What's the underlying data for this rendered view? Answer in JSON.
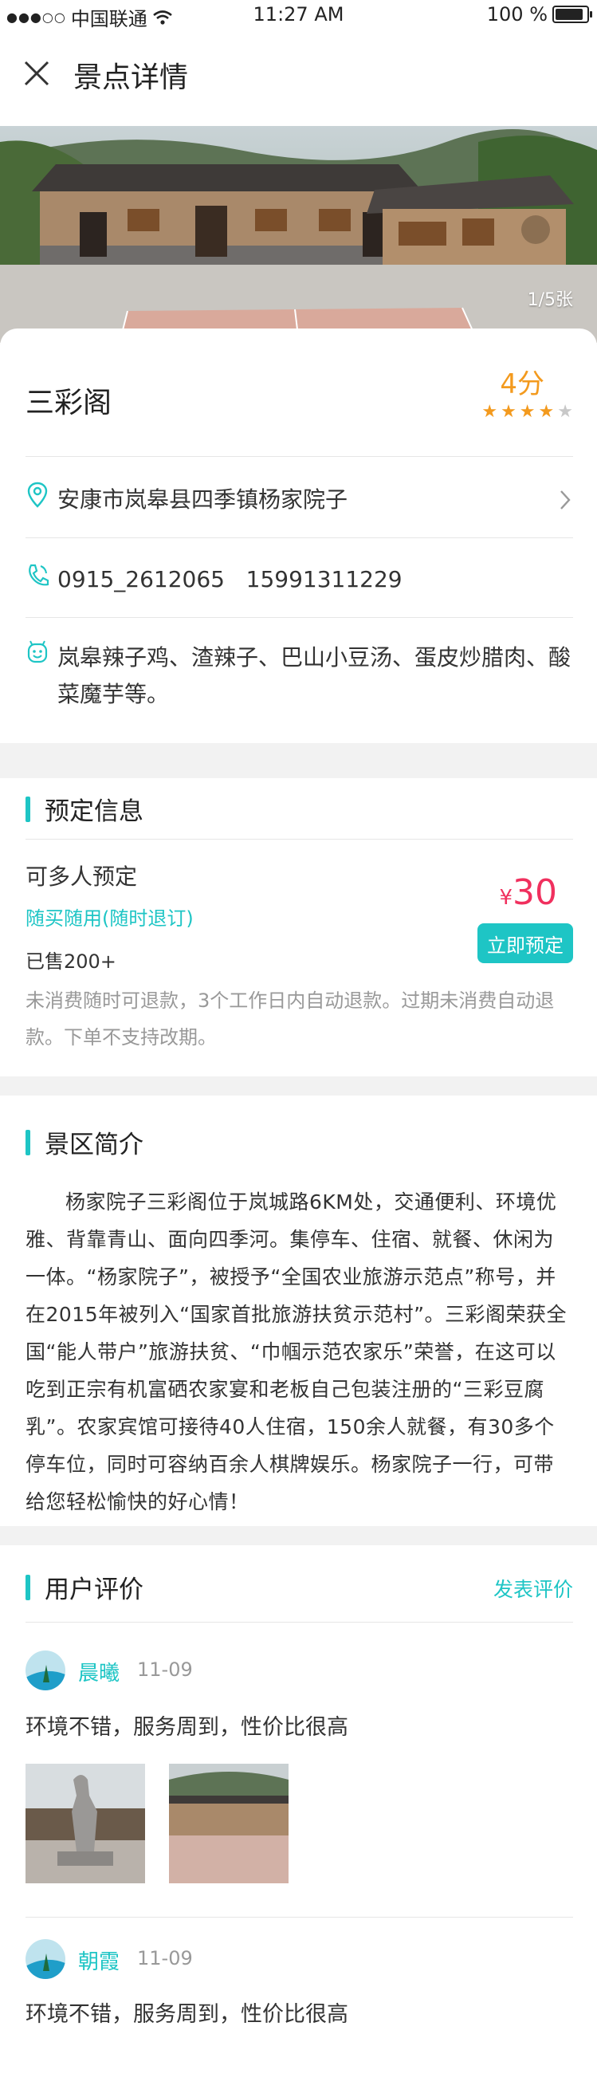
{
  "status_bar": {
    "carrier": "中国联通",
    "time": "11:27 AM",
    "battery": "100 %",
    "battery_level": 1.0
  },
  "nav": {
    "title": "景点详情",
    "close_icon": "close-icon"
  },
  "hero": {
    "counter": "1/5张"
  },
  "place": {
    "name": "三彩阁",
    "score": "4分",
    "rating": 4,
    "rating_max": 5,
    "address": "安康市岚皋县四季镇杨家院子",
    "phone": "0915_2612065   15991311229",
    "dishes": "岚皋辣子鸡、渣辣子、巴山小豆汤、蛋皮炒腊肉、酸菜魔芋等。"
  },
  "booking": {
    "title": "预定信息",
    "name": "可多人预定",
    "tag": "随买随用(随时退订)",
    "sold": "已售200+",
    "currency": "¥",
    "price": "30",
    "button": "立即预定",
    "note": "未消费随时可退款，3个工作日内自动退款。过期未消费自动退款。下单不支持改期。"
  },
  "intro": {
    "title": "景区简介",
    "text": "杨家院子三彩阁位于岚城路6KM处，交通便利、环境优雅、背靠青山、面向四季河。集停车、住宿、就餐、休闲为一体。“杨家院子”，被授予“全国农业旅游示范点”称号，并在2015年被列入“国家首批旅游扶贫示范村”。三彩阁荣获全国“能人带户”旅游扶贫、“巾帼示范农家乐”荣誉，在这可以吃到正宗有机富硒农家宴和老板自己包装注册的“三彩豆腐乳”。农家宾馆可接待40人住宿，150余人就餐，有30多个停车位，同时可容纳百余人棋牌娱乐。杨家院子一行，可带给您轻松愉快的好心情！"
  },
  "reviews": {
    "title": "用户评价",
    "post_label": "发表评价",
    "items": [
      {
        "name": "晨曦",
        "date": "11-09",
        "text": "环境不错，服务周到，性价比很高"
      },
      {
        "name": "朝霞",
        "date": "11-09",
        "text": "环境不错，服务周到，性价比很高"
      }
    ]
  },
  "colors": {
    "accent": "#1ec5c5",
    "price": "#f0305e",
    "star": "#f39a1e"
  }
}
